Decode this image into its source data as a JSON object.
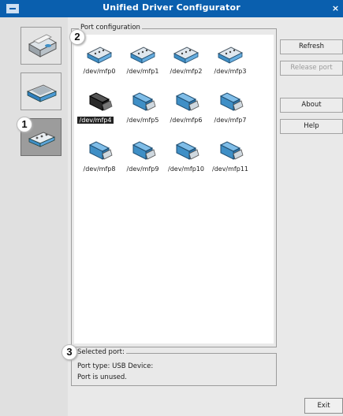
{
  "window": {
    "title": "Unified Driver Configurator",
    "close_glyph": "×"
  },
  "sidebar": {
    "items": [
      {
        "name": "printers",
        "icon": "printer-icon"
      },
      {
        "name": "scanners",
        "icon": "scanner-icon"
      },
      {
        "name": "ports",
        "icon": "port-icon",
        "active": true
      }
    ]
  },
  "port_config": {
    "legend": "Port configuration",
    "ports": [
      {
        "label": "/dev/mfp0",
        "type": "parallel",
        "selected": false
      },
      {
        "label": "/dev/mfp1",
        "type": "parallel",
        "selected": false
      },
      {
        "label": "/dev/mfp2",
        "type": "parallel",
        "selected": false
      },
      {
        "label": "/dev/mfp3",
        "type": "parallel",
        "selected": false
      },
      {
        "label": "/dev/mfp4",
        "type": "usb",
        "selected": true
      },
      {
        "label": "/dev/mfp5",
        "type": "usb",
        "selected": false
      },
      {
        "label": "/dev/mfp6",
        "type": "usb",
        "selected": false
      },
      {
        "label": "/dev/mfp7",
        "type": "usb",
        "selected": false
      },
      {
        "label": "/dev/mfp8",
        "type": "usb",
        "selected": false
      },
      {
        "label": "/dev/mfp9",
        "type": "usb",
        "selected": false
      },
      {
        "label": "/dev/mfp10",
        "type": "usb",
        "selected": false
      },
      {
        "label": "/dev/mfp11",
        "type": "usb",
        "selected": false
      }
    ]
  },
  "selected_port": {
    "legend": "Selected port:",
    "type_line": "Port type: USB   Device:",
    "status_line": "Port is unused."
  },
  "buttons": {
    "refresh": "Refresh",
    "release_port": "Release port",
    "about": "About",
    "help": "Help",
    "exit": "Exit"
  },
  "callouts": {
    "one": "1",
    "two": "2",
    "three": "3"
  },
  "colors": {
    "titlebar": "#0a5fae",
    "icon_blue": "#3f8fc6",
    "selected_bg": "#222222"
  }
}
